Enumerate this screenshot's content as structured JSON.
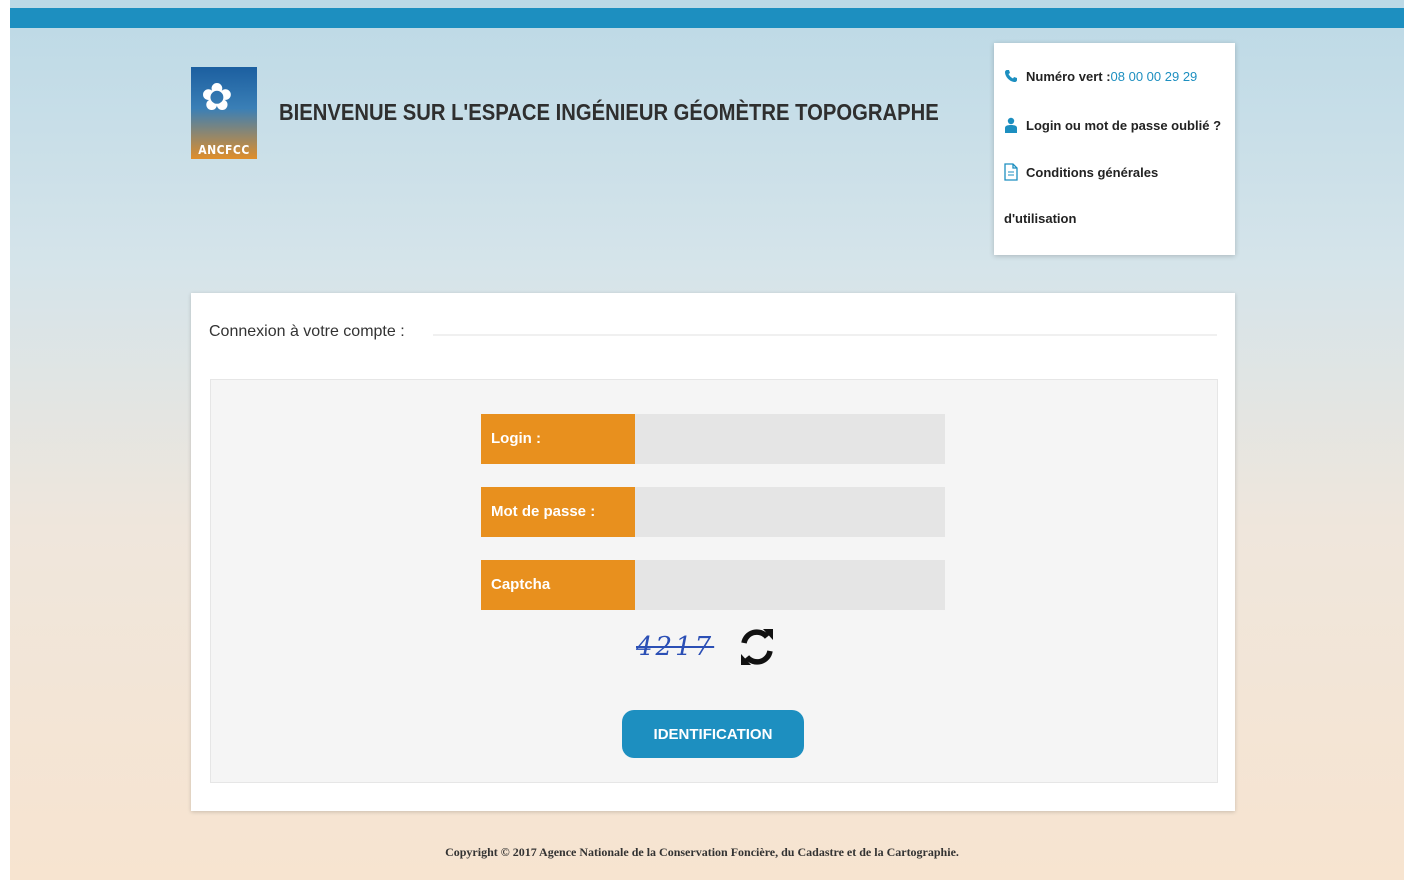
{
  "header": {
    "logo_text": "ANCFCC",
    "title": "BIENVENUE SUR L'ESPACE INGÉNIEUR GÉOMÈTRE TOPOGRAPHE"
  },
  "info_box": {
    "phone_label": "Numéro vert : ",
    "phone_number": "08 00 00 29 29",
    "forgot_label": "Login ou mot de passe oublié ?",
    "conditions_line1": "Conditions générales",
    "conditions_line2": "d'utilisation"
  },
  "login_card": {
    "title": "Connexion à votre compte :",
    "login_label": "Login :",
    "login_value": "",
    "password_label": "Mot de passe :",
    "password_value": "",
    "captcha_label": "Captcha",
    "captcha_value": "",
    "captcha_image_text": "4217",
    "submit_label": "IDENTIFICATION"
  },
  "footer": {
    "copyright": "Copyright © 2017 Agence Nationale de la Conservation Foncière, du Cadastre et de la Cartographie."
  },
  "colors": {
    "accent_blue": "#1d8fc0",
    "label_orange": "#e8901e"
  },
  "icons": {
    "phone": "phone-icon",
    "user": "user-icon",
    "document": "document-icon",
    "refresh": "refresh-icon"
  }
}
